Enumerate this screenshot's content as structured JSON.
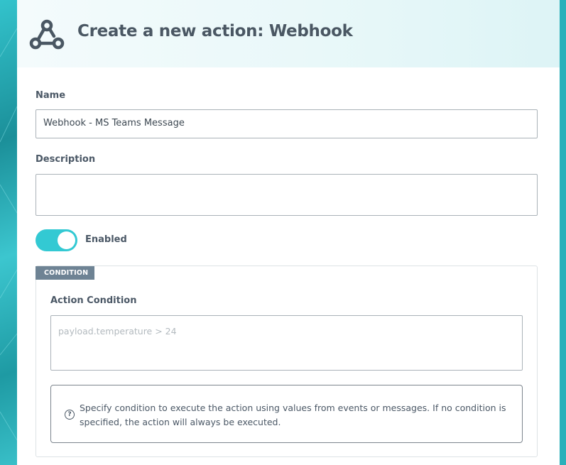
{
  "header": {
    "title": "Create a new action: Webhook",
    "icon": "webhook-icon"
  },
  "form": {
    "name_label": "Name",
    "name_value": "Webhook - MS Teams Message",
    "description_label": "Description",
    "description_value": "",
    "enabled_label": "Enabled",
    "enabled": true
  },
  "condition": {
    "tag": "CONDITION",
    "label": "Action Condition",
    "placeholder": "payload.temperature > 24",
    "value": "",
    "info_icon": "question-circle-icon",
    "info_text": "Specify condition to execute the action using values from events or messages. If no condition is specified, the action will always be executed."
  },
  "colors": {
    "accent": "#33c9d3",
    "tag_background": "#6e8394",
    "title_text": "#4a5763"
  }
}
